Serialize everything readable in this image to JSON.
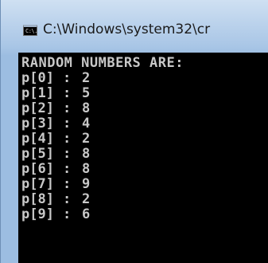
{
  "window": {
    "title": "C:\\Windows\\system32\\cr",
    "icon": "cmd-icon",
    "icon_text": "C:\\."
  },
  "console": {
    "header": "RANDOM NUMBERS ARE:",
    "separator": ":",
    "rows": [
      {
        "index": "p[0]",
        "value": "2"
      },
      {
        "index": "p[1]",
        "value": "5"
      },
      {
        "index": "p[2]",
        "value": "8"
      },
      {
        "index": "p[3]",
        "value": "4"
      },
      {
        "index": "p[4]",
        "value": "2"
      },
      {
        "index": "p[5]",
        "value": "8"
      },
      {
        "index": "p[6]",
        "value": "8"
      },
      {
        "index": "p[7]",
        "value": "9"
      },
      {
        "index": "p[8]",
        "value": "2"
      },
      {
        "index": "p[9]",
        "value": "6"
      }
    ]
  }
}
